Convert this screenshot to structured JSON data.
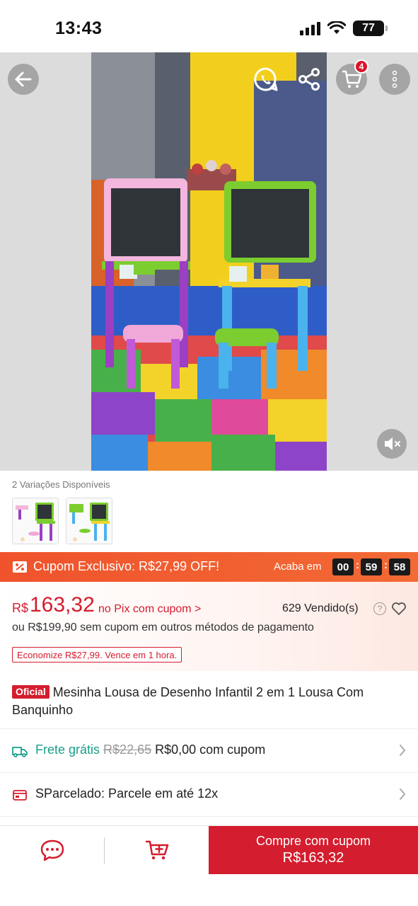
{
  "status": {
    "time": "13:43",
    "battery": "77"
  },
  "media": {
    "cart_count": "4"
  },
  "variations": {
    "label": "2 Variações Disponíveis"
  },
  "coupon": {
    "text": "Cupom Exclusivo: R$27,99 OFF!",
    "ends_label": "Acaba em",
    "hours": "00",
    "minutes": "59",
    "seconds": "58"
  },
  "price": {
    "currency": "R$",
    "value": "163,32",
    "pix_label": "no Pix com cupom >",
    "sold": "629 Vendido(s)",
    "other_payment": "ou R$199,90 sem cupom em outros métodos de pagamento",
    "save_badge": "Economize R$27,99. Vence em 1 hora."
  },
  "product": {
    "official_badge": "Oficial",
    "title": "Mesinha Lousa de Desenho Infantil 2 em 1 Lousa Com Banquinho"
  },
  "shipping": {
    "free_label": "Frete grátis",
    "old_price": "R$22,65",
    "new_price": "R$0,00 com cupom"
  },
  "installments": {
    "text": "SParcelado: Parcele em até 12x"
  },
  "bottom_bar": {
    "buy_label": "Compre com cupom",
    "buy_price": "R$163,32"
  },
  "colors": {
    "brand_red": "#d41d2e",
    "coupon_orange": "#f0532c",
    "free_shipping_teal": "#1a9e8a"
  },
  "icons": [
    "back-arrow-icon",
    "whatsapp-icon",
    "share-icon",
    "cart-icon",
    "more-icon",
    "mute-icon",
    "coupon-icon",
    "help-icon",
    "heart-icon",
    "truck-icon",
    "card-icon",
    "chevron-right-icon",
    "chat-icon",
    "add-to-cart-icon"
  ]
}
